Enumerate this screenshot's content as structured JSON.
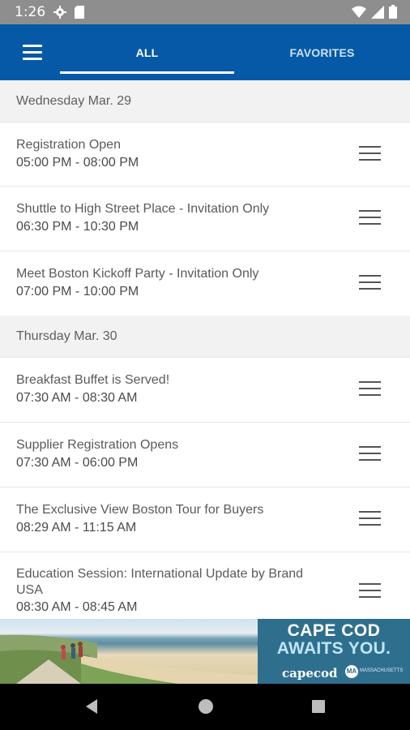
{
  "status_bar": {
    "time": "1:26",
    "left_icons": [
      "gear-icon",
      "sd-card-icon"
    ],
    "right_icons": [
      "wifi-icon",
      "signal-icon",
      "battery-icon"
    ]
  },
  "app_bar": {
    "background": "#0659a7",
    "menu_icon": "hamburger-menu-icon",
    "tabs": [
      {
        "label": "ALL",
        "selected": true
      },
      {
        "label": "FAVORITES",
        "selected": false
      }
    ]
  },
  "sections": [
    {
      "date": "Wednesday Mar. 29",
      "events": [
        {
          "title": "Registration Open",
          "time": "05:00 PM - 08:00 PM"
        },
        {
          "title": "Shuttle to High Street Place - Invitation Only",
          "time": "06:30 PM - 10:30 PM"
        },
        {
          "title": "Meet Boston Kickoff Party - Invitation Only",
          "time": "07:00 PM - 10:00 PM"
        }
      ]
    },
    {
      "date": "Thursday Mar. 30",
      "events": [
        {
          "title": "Breakfast Buffet is Served!",
          "time": "07:30 AM - 08:30 AM"
        },
        {
          "title": "Supplier Registration Opens",
          "time": "07:30 AM - 06:00 PM"
        },
        {
          "title": "The Exclusive View Boston Tour for Buyers",
          "time": "08:29 AM - 11:15 AM"
        },
        {
          "title": "Education Session: International Update by Brand USA",
          "time": "08:30 AM - 08:45 AM"
        }
      ]
    }
  ],
  "ad_banner": {
    "headline_line1": "CAPE COD",
    "headline_line2": "AWAITS YOU.",
    "brand": "capecod",
    "badge": "MA",
    "badge_text": "MASSACHUSETTS",
    "colors": {
      "panel": "#2f6f8e",
      "accent": "#bfe6f7"
    }
  },
  "nav_bar": {
    "buttons": [
      "back-icon",
      "home-icon",
      "recents-icon"
    ]
  }
}
